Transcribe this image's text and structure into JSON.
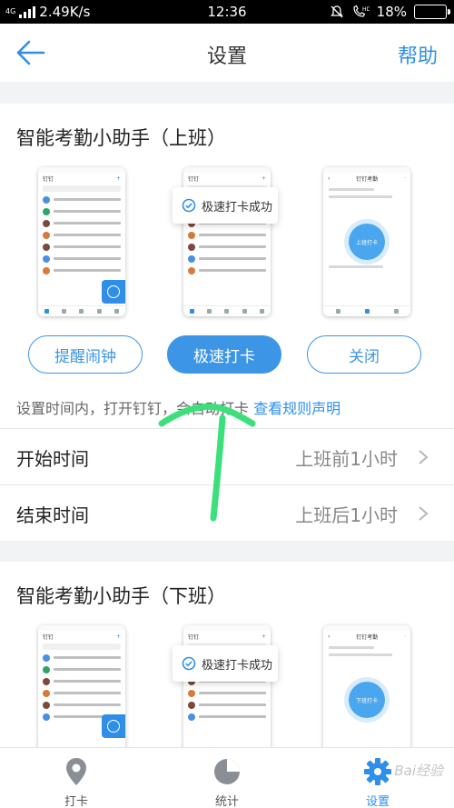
{
  "status_bar": {
    "network": "4G",
    "speed": "2.49K/s",
    "time": "12:36",
    "battery": "18%",
    "battery_level": 0.18
  },
  "nav": {
    "title": "设置",
    "help": "帮助",
    "back_icon": "arrow-left-icon"
  },
  "section_on": {
    "title": "智能考勤小助手（上班）",
    "toast": "极速打卡成功",
    "buttons": [
      "提醒闹钟",
      "极速打卡",
      "关闭"
    ],
    "active_index": 1,
    "description": "设置时间内，打开钉钉，会自动打卡",
    "rule_link": "查看规则声明",
    "rows": [
      {
        "label": "开始时间",
        "value": "上班前1小时"
      },
      {
        "label": "结束时间",
        "value": "上班后1小时"
      }
    ]
  },
  "section_off": {
    "title": "智能考勤小助手（下班）",
    "toast": "极速打卡成功"
  },
  "tabbar": {
    "tabs": [
      {
        "label": "打卡",
        "icon": "location-pin-icon"
      },
      {
        "label": "统计",
        "icon": "pie-chart-icon"
      },
      {
        "label": "设置",
        "icon": "gear-icon",
        "active": true
      }
    ],
    "watermark": "Bai经验"
  },
  "colors": {
    "accent": "#3d95e6",
    "link": "#2f8fe8",
    "annotation": "#3be07a"
  }
}
